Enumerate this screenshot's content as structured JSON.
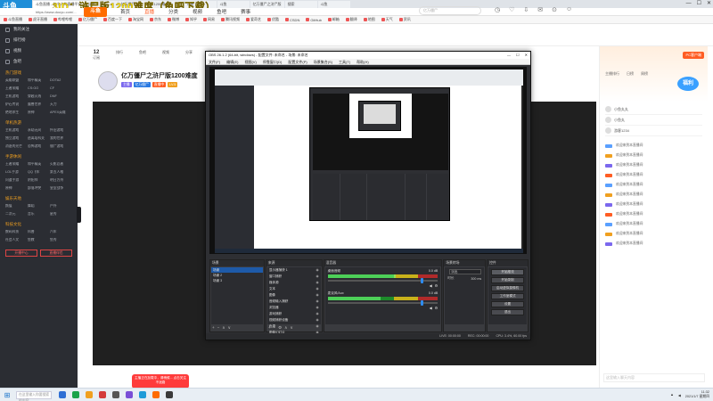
{
  "overlay": {
    "text": "...3ID：浒尸版1200难度（鱼吧下载）"
  },
  "corner_logo": "斗鱼",
  "browser": {
    "tabs": [
      "直播",
      "斗鱼直播 - 每个人的直播平台",
      "斗鱼",
      "亿万僵尸",
      "1200难度",
      "斗鱼 · 虎牙",
      "斗鱼",
      "亿万僵尸之浒尸版",
      "搜索",
      "斗鱼"
    ],
    "address": "https://www.douyu.com/...",
    "bookmarks": [
      "斗鱼直播",
      "虎牙直播",
      "哔哩哔哩",
      "亿万僵尸",
      "百度一下",
      "淘宝网",
      "京东",
      "微博",
      "知乎",
      "网易",
      "腾讯视频",
      "爱奇艺",
      "优酷",
      "CSDN",
      "GitHub",
      "邮箱",
      "翻译",
      "地图",
      "天气",
      "资讯"
    ]
  },
  "sidebar": {
    "items": [
      "我的关注",
      "排行榜",
      "视频",
      "鱼吧"
    ],
    "sections": [
      {
        "title": "热门游戏",
        "entries": [
          "英雄联盟",
          "和平精英",
          "DOTA2",
          "王者荣耀",
          "CS:GO",
          "CF",
          "主机游戏",
          "穿越火线",
          "DNF",
          "炉石传说",
          "魔兽世界",
          "天刀",
          "绝地求生",
          "原神",
          "APEX英雄"
        ]
      },
      {
        "title": "单机热游",
        "entries": [
          "主机游戏",
          "永劫无间",
          "怀旧游戏",
          "独立游戏",
          "逃离塔科夫",
          "我的世界",
          "消逝的光芒",
          "恐怖游戏",
          "僵尸游戏"
        ]
      },
      {
        "title": "手游休闲",
        "entries": [
          "王者荣耀",
          "和平精英",
          "火影忍者",
          "LOL手游",
          "QQ飞车",
          "第五人格",
          "问道手游",
          "阴阳师",
          "明日方舟",
          "原神",
          "部落冲突",
          "皇室战争"
        ]
      },
      {
        "title": "娱乐天地",
        "entries": [
          "颜值",
          "舞蹈",
          "户外",
          "二次元",
          "音乐",
          "星秀"
        ]
      },
      {
        "title": "科技文化",
        "entries": [
          "数码科技",
          "科普",
          "汽车",
          "社会人文",
          "鱼教",
          "鱼秀"
        ]
      }
    ],
    "buttons": [
      "开播中心",
      "直播伴侣"
    ]
  },
  "site": {
    "logo": "斗鱼",
    "nav": [
      "首页",
      "直播",
      "分类",
      "视频",
      "鱼吧",
      "赛事"
    ],
    "search_placeholder": "亿万僵尸"
  },
  "room": {
    "stats": [
      {
        "value": "12",
        "label": "订阅"
      },
      {
        "value": "",
        "label": "排行"
      },
      {
        "value": "",
        "label": "鱼吧"
      },
      {
        "value": "",
        "label": "视频"
      },
      {
        "value": "",
        "label": "分享"
      },
      {
        "value": "",
        "label": "礼物"
      }
    ],
    "title": "亿万僵尸之浒尸版1200难度",
    "badges": [
      "主播",
      "亿万僵尸",
      "直播中",
      "LV.5"
    ],
    "follow_label": "关注"
  },
  "chat": {
    "promo": "PC客户端",
    "tabs": [
      "主播排行",
      "日榜",
      "周榜"
    ],
    "gift_text": "福利",
    "ranks": [
      "小鱼丸丸",
      "小鱼丸",
      "游客1234"
    ],
    "messages": [
      "欢迎来到本直播间",
      "欢迎来到本直播间",
      "欢迎来到本直播间",
      "欢迎来到本直播间",
      "欢迎来到本直播间",
      "欢迎来到本直播间",
      "欢迎来到本直播间",
      "欢迎来到本直播间",
      "欢迎来到本直播间",
      "欢迎来到本直播间",
      "欢迎来到本直播间"
    ],
    "input_placeholder": "这里输入聊天内容"
  },
  "popup": {
    "text": "主播正在加载中，请稍候... 点击关注不迷路"
  },
  "obs": {
    "title": "OBS 26.1.2 (64-bit, windows) - 配置文件: 未命名 - 场景: 未命名",
    "menu": [
      "文件(F)",
      "编辑(E)",
      "视图(V)",
      "停靠窗口(D)",
      "配置文件(P)",
      "场景集合(S)",
      "工具(T)",
      "帮助(H)"
    ],
    "docks": {
      "scenes": {
        "title": "场景",
        "items": [
          "场景",
          "场景 2",
          "场景 3"
        ]
      },
      "sources": {
        "title": "来源",
        "items": [
          "显示器捕获 1",
          "窗口捕获",
          "媒体源",
          "文本",
          "图像",
          "音频输入捕获",
          "浏览器",
          "游戏捕获",
          "视频捕获设备",
          "色源",
          "图像幻灯片"
        ]
      },
      "mixer": {
        "title": "混音器",
        "channels": [
          {
            "name": "桌面音频",
            "db": "0.0 dB",
            "level": 0.62,
            "volume": 0.86
          },
          {
            "name": "麦克风/Aux",
            "db": "0.0 dB",
            "level": 0.48,
            "volume": 0.86
          }
        ]
      },
      "transitions": {
        "title": "场景转场",
        "type": "淡出",
        "duration_label": "时长",
        "duration": "300 ms"
      },
      "controls": {
        "title": "控件",
        "buttons": [
          "开始推流",
          "开始录制",
          "启动虚拟摄像机",
          "工作室模式",
          "设置",
          "退出"
        ]
      }
    },
    "status": [
      "LIVE: 00:00:00",
      "REC: 00:00:00",
      "CPU: 3.4%, 60.00 fps"
    ]
  },
  "taskbar": {
    "search_placeholder": "在这里输入你要搜索的内容",
    "app_colors": [
      "#2f6fd4",
      "#1aa34a",
      "#f0a020",
      "#d43b3b",
      "#555555",
      "#7a4fd6",
      "#1f9bd8",
      "#ff6c00",
      "#3a3a3a"
    ],
    "time": "11:32",
    "date": "2021/1/7 星期四"
  }
}
